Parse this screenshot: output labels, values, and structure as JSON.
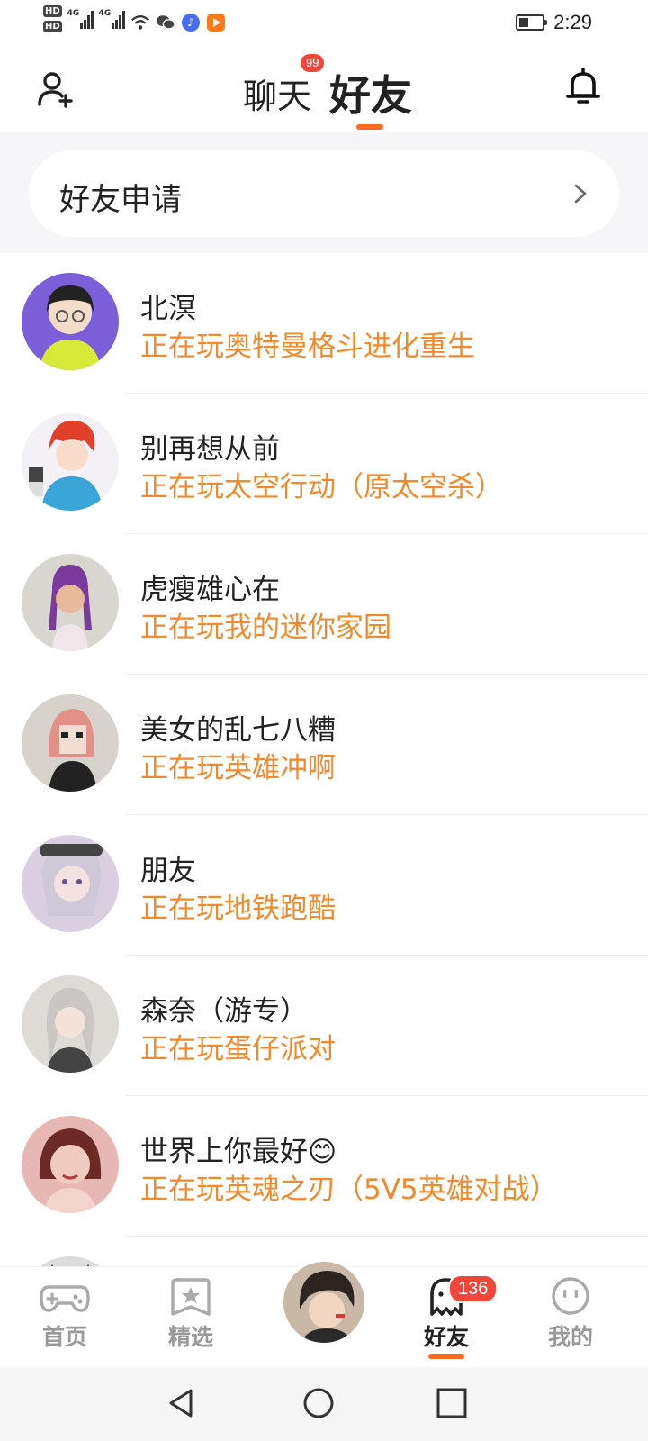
{
  "status_bar": {
    "hd1": "HD",
    "hd2": "HD",
    "net1": "4G",
    "net2": "4G",
    "battery_level": 0.4,
    "time": "2:29"
  },
  "header": {
    "tab_chat": "聊天",
    "chat_badge": "99",
    "tab_friends": "好友",
    "accent": "#ff6a1f"
  },
  "requests": {
    "label": "好友申请"
  },
  "friends": [
    {
      "name": "北溟",
      "status": "正在玩奥特曼格斗进化重生"
    },
    {
      "name": "别再想从前",
      "status": "正在玩太空行动（原太空杀）"
    },
    {
      "name": "虎瘦雄心在",
      "status": "正在玩我的迷你家园"
    },
    {
      "name": "美女的乱七八糟",
      "status": "正在玩英雄冲啊"
    },
    {
      "name": "朋友",
      "status": "正在玩地铁跑酷"
    },
    {
      "name": "森奈（游专）",
      "status": "正在玩蛋仔派对"
    },
    {
      "name": "世界上你最好😊",
      "status": "正在玩英魂之刃（5V5英雄对战）"
    }
  ],
  "bottom_nav": {
    "home": "首页",
    "featured": "精选",
    "friends": "好友",
    "friends_badge": "136",
    "mine": "我的"
  },
  "colors": {
    "status_text": "#f08a2c",
    "badge": "#f0473a"
  }
}
